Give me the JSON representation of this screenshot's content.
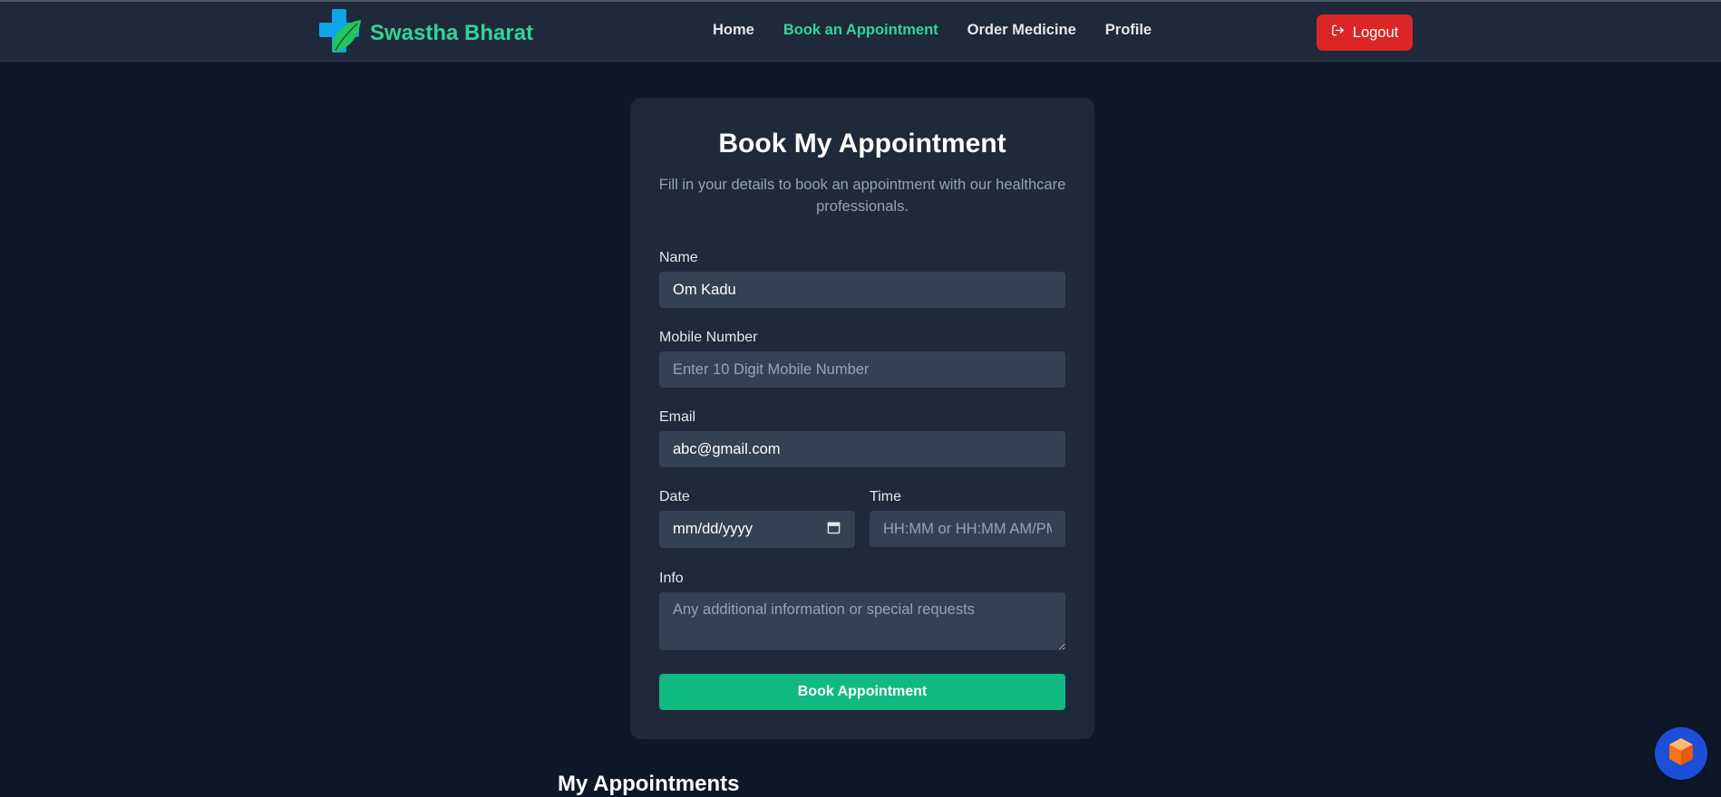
{
  "nav": {
    "brand": "Swastha Bharat",
    "links": [
      {
        "label": "Home",
        "active": false
      },
      {
        "label": "Book an Appointment",
        "active": true
      },
      {
        "label": "Order Medicine",
        "active": false
      },
      {
        "label": "Profile",
        "active": false
      }
    ],
    "logout_label": "Logout"
  },
  "form": {
    "title": "Book My Appointment",
    "subtitle": "Fill in your details to book an appointment with our healthcare professionals.",
    "name_label": "Name",
    "name_value": "Om Kadu",
    "mobile_label": "Mobile Number",
    "mobile_placeholder": "Enter 10 Digit Mobile Number",
    "email_label": "Email",
    "email_value": "abc@gmail.com",
    "date_label": "Date",
    "date_placeholder": "mm/dd/yyyy",
    "time_label": "Time",
    "time_placeholder": "HH:MM or HH:MM AM/PM",
    "info_label": "Info",
    "info_placeholder": "Any additional information or special requests",
    "submit_label": "Book Appointment"
  },
  "appointments_title": "My Appointments",
  "icons": {
    "logo": "medical-cross-leaf-icon",
    "logout": "logout-icon",
    "calendar": "calendar-icon",
    "assistant": "cube-icon"
  },
  "colors": {
    "background": "#0f172a",
    "card": "#1e293b",
    "input": "#334155",
    "accent": "#10b981",
    "brand": "#34d399",
    "danger": "#dc2626"
  }
}
